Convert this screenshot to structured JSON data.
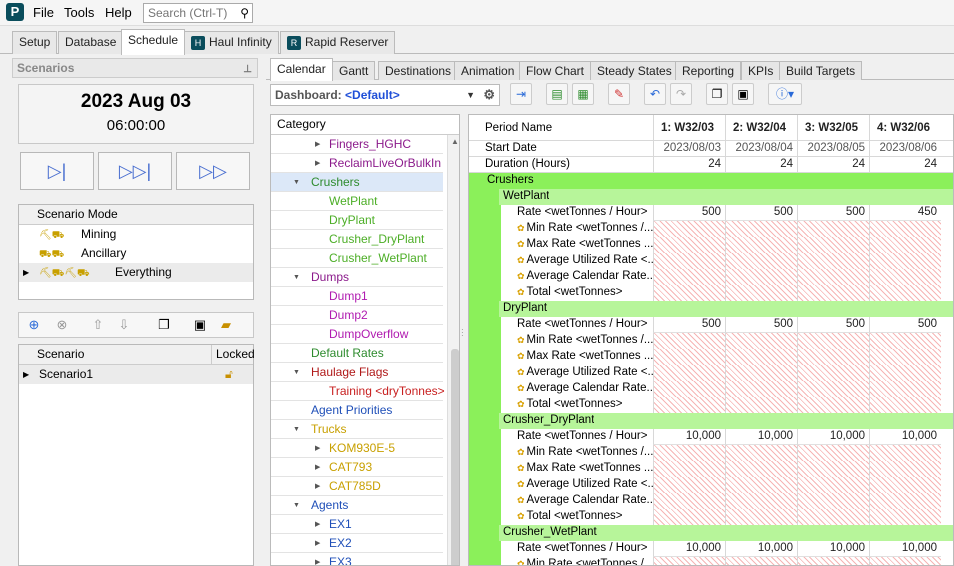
{
  "menu": {
    "file": "File",
    "tools": "Tools",
    "help": "Help",
    "search_placeholder": "Search (Ctrl-T)",
    "logo": "P"
  },
  "main_tabs": [
    "Setup",
    "Database",
    "Schedule",
    "Haul Infinity",
    "Rapid Reserver"
  ],
  "left": {
    "title": "Scenarios",
    "date": "2023 Aug 03",
    "time": "06:00:00",
    "mode_header": "Scenario Mode",
    "modes": [
      "Mining",
      "Ancillary",
      "Everything"
    ],
    "scenario_header": "Scenario",
    "locked_header": "Locked",
    "scenarios": [
      "Scenario1"
    ]
  },
  "sub_tabs": [
    "Calendar",
    "Gantt",
    "Destinations",
    "Animation",
    "Flow Chart",
    "Steady States",
    "Reporting",
    "KPIs",
    "Build Targets"
  ],
  "dashboard": {
    "label": "Dashboard:",
    "value": "<Default>"
  },
  "category": {
    "header": "Category",
    "items": [
      {
        "t": "Fingers_HGHC",
        "c": "#8b1a8b"
      },
      {
        "t": "ReclaimLiveOrBulkIn",
        "c": "#8b1a8b"
      },
      {
        "t": "Crushers",
        "c": "#2e8b2e"
      },
      {
        "t": "WetPlant",
        "c": "#4cae26"
      },
      {
        "t": "DryPlant",
        "c": "#4cae26"
      },
      {
        "t": "Crusher_DryPlant",
        "c": "#4cae26"
      },
      {
        "t": "Crusher_WetPlant",
        "c": "#4cae26"
      },
      {
        "t": "Dumps",
        "c": "#8b1a8b"
      },
      {
        "t": "Dump1",
        "c": "#b01ab0"
      },
      {
        "t": "Dump2",
        "c": "#b01ab0"
      },
      {
        "t": "DumpOverflow",
        "c": "#b01ab0"
      },
      {
        "t": "Default Rates",
        "c": "#2e8b2e"
      },
      {
        "t": "Haulage Flags",
        "c": "#b01818"
      },
      {
        "t": "Training <dryTonnes>",
        "c": "#c82020"
      },
      {
        "t": "Agent Priorities",
        "c": "#1f4fb8"
      },
      {
        "t": "Trucks",
        "c": "#c8a000"
      },
      {
        "t": "KOM930E-5",
        "c": "#c8a000"
      },
      {
        "t": "CAT793",
        "c": "#c8a000"
      },
      {
        "t": "CAT785D",
        "c": "#c8a000"
      },
      {
        "t": "Agents",
        "c": "#1f4fb8"
      },
      {
        "t": "EX1",
        "c": "#1f4fb8"
      },
      {
        "t": "EX2",
        "c": "#1f4fb8"
      },
      {
        "t": "EX3",
        "c": "#1f4fb8"
      }
    ]
  },
  "grid": {
    "period_label": "Period Name",
    "periods": [
      "1: W32/03",
      "2: W32/04",
      "3: W32/05",
      "4: W32/06"
    ],
    "start_label": "Start Date",
    "start_dates": [
      "2023/08/03",
      "2023/08/04",
      "2023/08/05",
      "2023/08/06"
    ],
    "duration_label": "Duration (Hours)",
    "durations": [
      "24",
      "24",
      "24",
      "24"
    ],
    "section": "Crushers",
    "rate_label": "Rate <wetTonnes / Hour>",
    "metric_labels": [
      "Min Rate <wetTonnes /...",
      "Max Rate <wetTonnes ...",
      "Average Utilized Rate <...",
      "Average Calendar Rate...",
      "Total <wetTonnes>"
    ],
    "groups": [
      {
        "name": "WetPlant",
        "rates": [
          "500",
          "500",
          "500",
          "450"
        ]
      },
      {
        "name": "DryPlant",
        "rates": [
          "500",
          "500",
          "500",
          "500"
        ]
      },
      {
        "name": "Crusher_DryPlant",
        "rates": [
          "10,000",
          "10,000",
          "10,000",
          "10,000"
        ]
      },
      {
        "name": "Crusher_WetPlant",
        "rates": [
          "10,000",
          "10,000",
          "10,000",
          "10,000"
        ]
      }
    ],
    "last_min_label": "Min Rate <wetTonnes /..."
  }
}
